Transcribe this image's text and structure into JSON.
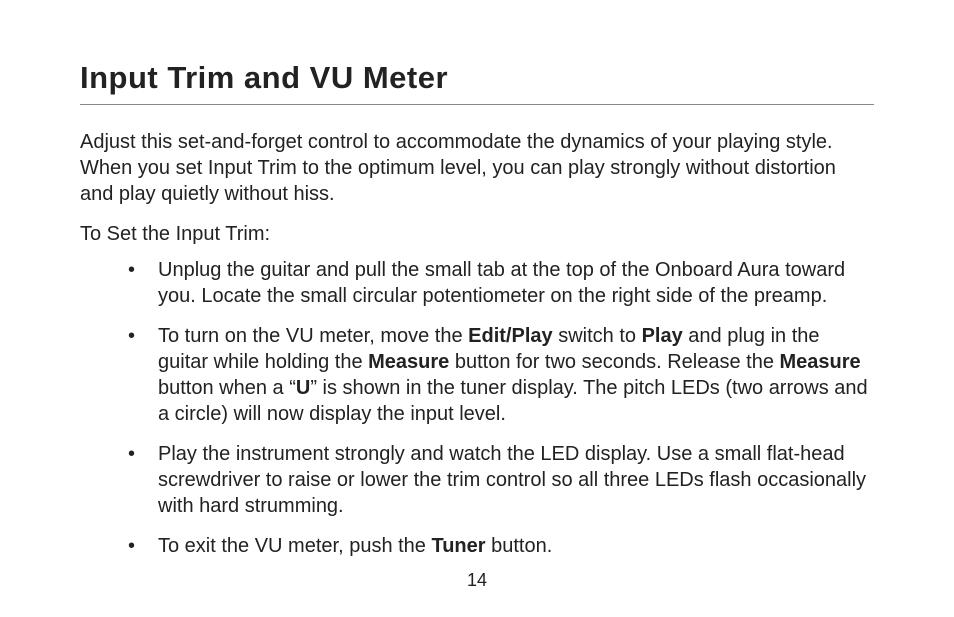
{
  "title": "Input Trim and VU Meter",
  "intro": "Adjust this set-and-forget control to accommodate the dynamics of your playing style. When you set Input Trim to the optimum level, you can play strongly without distortion and play quietly without hiss.",
  "subhead": "To Set the Input Trim:",
  "bullets": {
    "b1": "Unplug the guitar and pull the small tab at the top of the Onboard Aura toward you. Locate the small circular potentiometer on the right side of the preamp.",
    "b2": {
      "pre": "To turn on the VU meter, move the ",
      "bold1": "Edit/Play",
      "mid1": " switch to ",
      "bold2": "Play",
      "mid2": " and plug in the guitar while holding the ",
      "bold3": "Measure",
      "mid3": " button for two seconds. Release the ",
      "bold4": "Measure",
      "mid4": " button when a “",
      "bold5": "U",
      "post": "” is shown in the tuner display. The pitch LEDs (two arrows and a circle) will now display the input level."
    },
    "b3": "Play the instrument strongly and watch the LED display. Use a small flat-head screwdriver to raise or lower the trim control so all three LEDs flash occasionally with hard strumming.",
    "b4": {
      "pre": "To exit the VU meter, push the ",
      "bold1": "Tuner",
      "post": " button."
    }
  },
  "page_number": "14"
}
